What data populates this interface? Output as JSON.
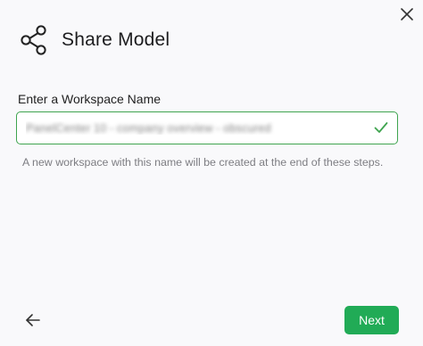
{
  "dialog": {
    "title": "Share Model",
    "close_icon": "close-icon",
    "share_icon": "share-icon"
  },
  "workspace": {
    "label": "Enter a Workspace Name",
    "value": "PanelCenter 10 - company overview - obscured",
    "valid_icon": "checkmark-icon",
    "helper_text": "A new workspace with this name will be created at the end of these steps."
  },
  "footer": {
    "back_icon": "arrow-left-icon",
    "next_label": "Next"
  },
  "colors": {
    "accent": "#21ab56",
    "valid_border": "#3fa44f"
  }
}
